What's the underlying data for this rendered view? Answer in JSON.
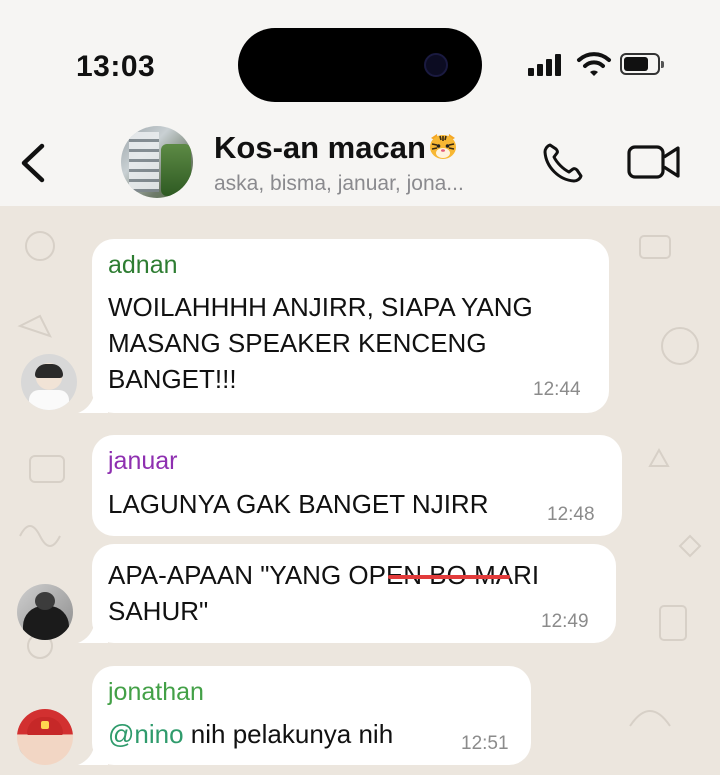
{
  "status_bar": {
    "time": "13:03"
  },
  "header": {
    "title": "Kos-an macan",
    "subtitle": "aska, bisma, januar, jona..."
  },
  "messages": [
    {
      "sender": "adnan",
      "sender_color": "#2e7d32",
      "text": "WOILAHHHH ANJIRR, SIAPA YANG MASANG SPEAKER KENCENG BANGET!!!",
      "time": "12:44"
    },
    {
      "sender": "januar",
      "sender_color": "#8e2fb0",
      "text": "LAGUNYA GAK BANGET NJIRR",
      "time": "12:48"
    },
    {
      "sender": "",
      "text": "APA-APAAN \"YANG OPEN BO MARI SAHUR\"",
      "time": "12:49"
    },
    {
      "sender": "jonathan",
      "sender_color": "#43a047",
      "mention": "@nino",
      "text": " nih pelakunya nih",
      "time": "12:51"
    }
  ],
  "colors": {
    "header_bg": "#f6f5f3",
    "chat_bg": "#ece6de",
    "bubble_bg": "#ffffff",
    "strike": "#e23b3b"
  }
}
